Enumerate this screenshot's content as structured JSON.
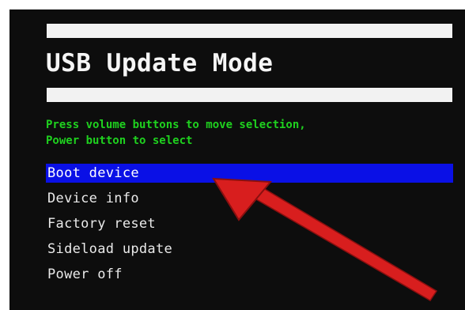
{
  "screen": {
    "title": "USB Update Mode",
    "instructions": [
      "Press volume buttons to move selection,",
      "Power button to select"
    ],
    "menu": [
      {
        "label": "Boot device",
        "selected": true
      },
      {
        "label": "Device info",
        "selected": false
      },
      {
        "label": "Factory reset",
        "selected": false
      },
      {
        "label": "Sideload update",
        "selected": false
      },
      {
        "label": "Power off",
        "selected": false
      }
    ]
  },
  "colors": {
    "background": "#0d0d0d",
    "bar": "#f2f2f2",
    "instruction_text": "#1fd11f",
    "selection": "#0a10e6",
    "arrow": "#d81e1e"
  },
  "annotation": {
    "icon": "red-arrow-icon"
  }
}
